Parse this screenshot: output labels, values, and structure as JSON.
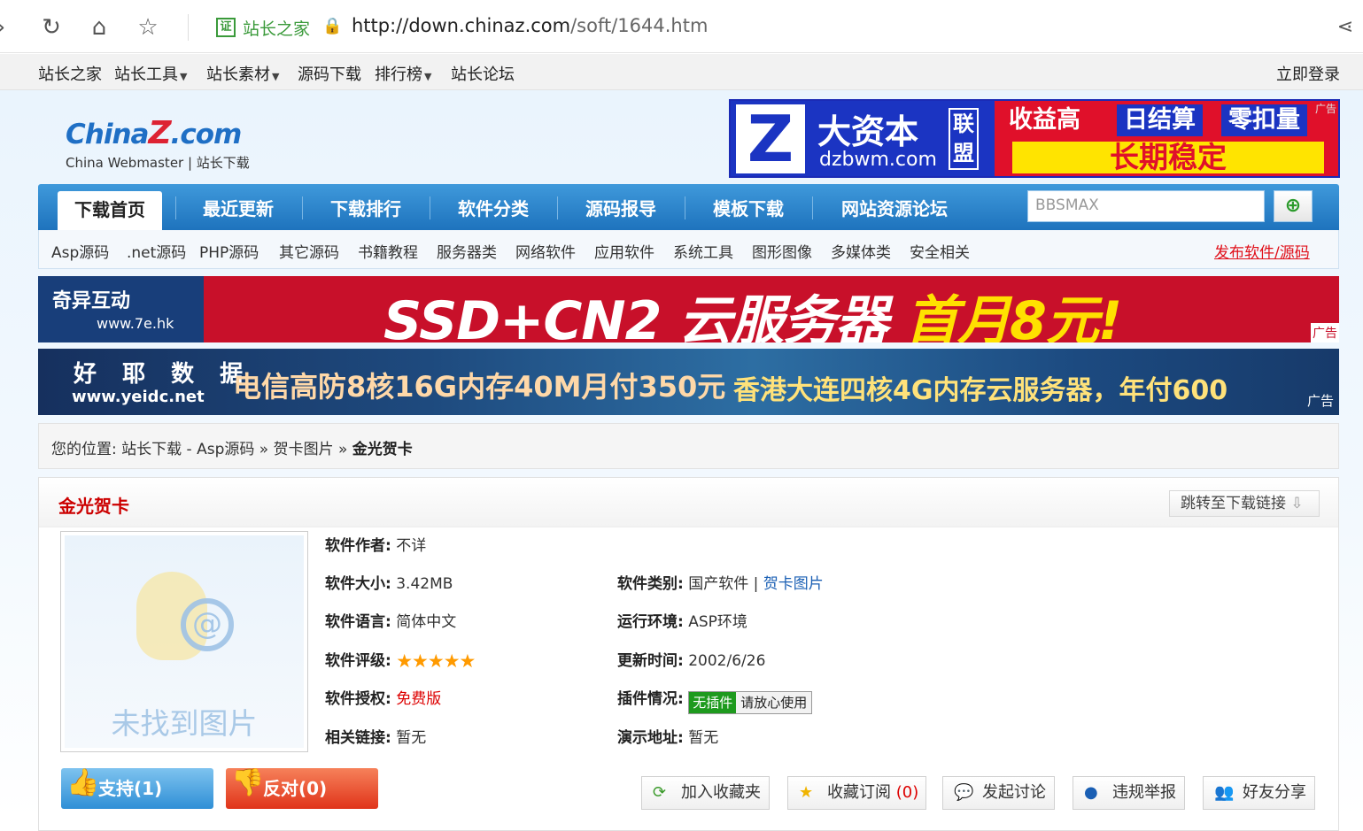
{
  "browser": {
    "site_name": "站长之家",
    "url_domain": "http://down.chinaz.com",
    "url_path": "/soft/1644.htm"
  },
  "topnav": {
    "items": [
      "站长之家",
      "站长工具",
      "站长素材",
      "源码下载",
      "排行榜",
      "站长论坛"
    ],
    "login": "立即登录"
  },
  "logo": {
    "main_a": "China",
    "main_z": "Z",
    "main_b": ".com",
    "sub": "China Webmaster | 站长下载"
  },
  "ad_top": {
    "brand": "大资本",
    "domain": "dzbwm.com",
    "union": "联盟",
    "k1": "收益高",
    "k2": "日结算",
    "k3": "零扣量",
    "slogan": "长期稳定",
    "tag": "广告"
  },
  "mainnav": {
    "tabs": [
      "下载首页",
      "最近更新",
      "下载排行",
      "软件分类",
      "源码报导",
      "模板下载",
      "网站资源论坛"
    ],
    "search_placeholder": "BBSMAX"
  },
  "subnav": {
    "items": [
      "Asp源码",
      ".net源码",
      "PHP源码",
      "其它源码",
      "书籍教程",
      "服务器类",
      "网络软件",
      "应用软件",
      "系统工具",
      "图形图像",
      "多媒体类",
      "安全相关"
    ],
    "publish": "发布软件/源码"
  },
  "banner1": {
    "brand": "奇异互动",
    "domain": "www.7e.hk",
    "text": "SSD+CN2 云服务器",
    "highlight": "首月8元!",
    "tag": "广告"
  },
  "banner2": {
    "brand": "好 耶 数 据",
    "domain": "www.yeidc.net",
    "text1": "电信高防8核16G内存40M月付350元",
    "text2": "香港大连四核4G内存云服务器，年付600",
    "tag": "广告"
  },
  "breadcrumb": {
    "label": "您的位置:",
    "path": "站长下载 - Asp源码 » 贺卡图片 »",
    "current": "金光贺卡"
  },
  "detail": {
    "title": "金光贺卡",
    "jump": "跳转至下载链接",
    "no_image": "未找到图片",
    "author_label": "软件作者:",
    "author": "不详",
    "size_label": "软件大小:",
    "size": "3.42MB",
    "category_label": "软件类别:",
    "category": "国产软件 |",
    "category_link": "贺卡图片",
    "lang_label": "软件语言:",
    "lang": "简体中文",
    "env_label": "运行环境:",
    "env": "ASP环境",
    "rating_label": "软件评级:",
    "rating": 5,
    "updated_label": "更新时间:",
    "updated": "2002/6/26",
    "license_label": "软件授权:",
    "license": "免费版",
    "plugin_label": "插件情况:",
    "plugin_badge": "无插件",
    "plugin_note": "请放心使用",
    "related_label": "相关链接:",
    "related": "暂无",
    "demo_label": "演示地址:",
    "demo": "暂无"
  },
  "votes": {
    "support": "支持(1)",
    "oppose": "反对(0)"
  },
  "actions": {
    "favorite": "加入收藏夹",
    "subscribe": "收藏订阅",
    "subscribe_count": "(0)",
    "discuss": "发起讨论",
    "report": "违规举报",
    "share": "好友分享"
  }
}
